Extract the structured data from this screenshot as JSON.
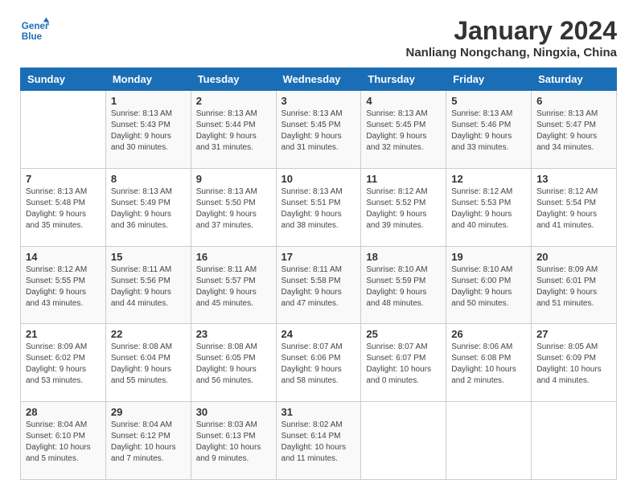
{
  "logo": {
    "line1": "General",
    "line2": "Blue"
  },
  "title": "January 2024",
  "subtitle": "Nanliang Nongchang, Ningxia, China",
  "days_of_week": [
    "Sunday",
    "Monday",
    "Tuesday",
    "Wednesday",
    "Thursday",
    "Friday",
    "Saturday"
  ],
  "weeks": [
    [
      {
        "day": "",
        "info": ""
      },
      {
        "day": "1",
        "info": "Sunrise: 8:13 AM\nSunset: 5:43 PM\nDaylight: 9 hours\nand 30 minutes."
      },
      {
        "day": "2",
        "info": "Sunrise: 8:13 AM\nSunset: 5:44 PM\nDaylight: 9 hours\nand 31 minutes."
      },
      {
        "day": "3",
        "info": "Sunrise: 8:13 AM\nSunset: 5:45 PM\nDaylight: 9 hours\nand 31 minutes."
      },
      {
        "day": "4",
        "info": "Sunrise: 8:13 AM\nSunset: 5:45 PM\nDaylight: 9 hours\nand 32 minutes."
      },
      {
        "day": "5",
        "info": "Sunrise: 8:13 AM\nSunset: 5:46 PM\nDaylight: 9 hours\nand 33 minutes."
      },
      {
        "day": "6",
        "info": "Sunrise: 8:13 AM\nSunset: 5:47 PM\nDaylight: 9 hours\nand 34 minutes."
      }
    ],
    [
      {
        "day": "7",
        "info": "Sunrise: 8:13 AM\nSunset: 5:48 PM\nDaylight: 9 hours\nand 35 minutes."
      },
      {
        "day": "8",
        "info": "Sunrise: 8:13 AM\nSunset: 5:49 PM\nDaylight: 9 hours\nand 36 minutes."
      },
      {
        "day": "9",
        "info": "Sunrise: 8:13 AM\nSunset: 5:50 PM\nDaylight: 9 hours\nand 37 minutes."
      },
      {
        "day": "10",
        "info": "Sunrise: 8:13 AM\nSunset: 5:51 PM\nDaylight: 9 hours\nand 38 minutes."
      },
      {
        "day": "11",
        "info": "Sunrise: 8:12 AM\nSunset: 5:52 PM\nDaylight: 9 hours\nand 39 minutes."
      },
      {
        "day": "12",
        "info": "Sunrise: 8:12 AM\nSunset: 5:53 PM\nDaylight: 9 hours\nand 40 minutes."
      },
      {
        "day": "13",
        "info": "Sunrise: 8:12 AM\nSunset: 5:54 PM\nDaylight: 9 hours\nand 41 minutes."
      }
    ],
    [
      {
        "day": "14",
        "info": "Sunrise: 8:12 AM\nSunset: 5:55 PM\nDaylight: 9 hours\nand 43 minutes."
      },
      {
        "day": "15",
        "info": "Sunrise: 8:11 AM\nSunset: 5:56 PM\nDaylight: 9 hours\nand 44 minutes."
      },
      {
        "day": "16",
        "info": "Sunrise: 8:11 AM\nSunset: 5:57 PM\nDaylight: 9 hours\nand 45 minutes."
      },
      {
        "day": "17",
        "info": "Sunrise: 8:11 AM\nSunset: 5:58 PM\nDaylight: 9 hours\nand 47 minutes."
      },
      {
        "day": "18",
        "info": "Sunrise: 8:10 AM\nSunset: 5:59 PM\nDaylight: 9 hours\nand 48 minutes."
      },
      {
        "day": "19",
        "info": "Sunrise: 8:10 AM\nSunset: 6:00 PM\nDaylight: 9 hours\nand 50 minutes."
      },
      {
        "day": "20",
        "info": "Sunrise: 8:09 AM\nSunset: 6:01 PM\nDaylight: 9 hours\nand 51 minutes."
      }
    ],
    [
      {
        "day": "21",
        "info": "Sunrise: 8:09 AM\nSunset: 6:02 PM\nDaylight: 9 hours\nand 53 minutes."
      },
      {
        "day": "22",
        "info": "Sunrise: 8:08 AM\nSunset: 6:04 PM\nDaylight: 9 hours\nand 55 minutes."
      },
      {
        "day": "23",
        "info": "Sunrise: 8:08 AM\nSunset: 6:05 PM\nDaylight: 9 hours\nand 56 minutes."
      },
      {
        "day": "24",
        "info": "Sunrise: 8:07 AM\nSunset: 6:06 PM\nDaylight: 9 hours\nand 58 minutes."
      },
      {
        "day": "25",
        "info": "Sunrise: 8:07 AM\nSunset: 6:07 PM\nDaylight: 10 hours\nand 0 minutes."
      },
      {
        "day": "26",
        "info": "Sunrise: 8:06 AM\nSunset: 6:08 PM\nDaylight: 10 hours\nand 2 minutes."
      },
      {
        "day": "27",
        "info": "Sunrise: 8:05 AM\nSunset: 6:09 PM\nDaylight: 10 hours\nand 4 minutes."
      }
    ],
    [
      {
        "day": "28",
        "info": "Sunrise: 8:04 AM\nSunset: 6:10 PM\nDaylight: 10 hours\nand 5 minutes."
      },
      {
        "day": "29",
        "info": "Sunrise: 8:04 AM\nSunset: 6:12 PM\nDaylight: 10 hours\nand 7 minutes."
      },
      {
        "day": "30",
        "info": "Sunrise: 8:03 AM\nSunset: 6:13 PM\nDaylight: 10 hours\nand 9 minutes."
      },
      {
        "day": "31",
        "info": "Sunrise: 8:02 AM\nSunset: 6:14 PM\nDaylight: 10 hours\nand 11 minutes."
      },
      {
        "day": "",
        "info": ""
      },
      {
        "day": "",
        "info": ""
      },
      {
        "day": "",
        "info": ""
      }
    ]
  ]
}
